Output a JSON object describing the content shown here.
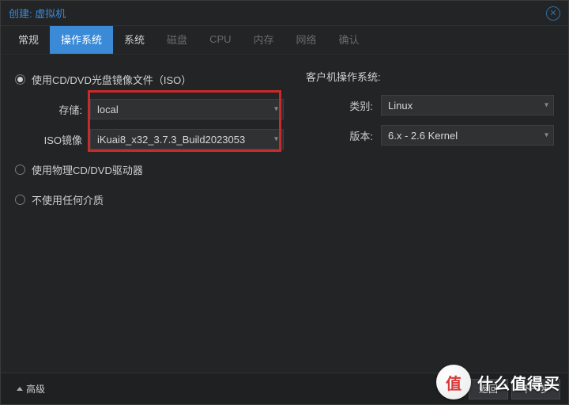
{
  "title": "创建: 虚拟机",
  "tabs": [
    {
      "label": "常规",
      "state": "normal"
    },
    {
      "label": "操作系统",
      "state": "active"
    },
    {
      "label": "系统",
      "state": "normal"
    },
    {
      "label": "磁盘",
      "state": "disabled"
    },
    {
      "label": "CPU",
      "state": "disabled"
    },
    {
      "label": "内存",
      "state": "disabled"
    },
    {
      "label": "网络",
      "state": "disabled"
    },
    {
      "label": "确认",
      "state": "disabled"
    }
  ],
  "media": {
    "options": {
      "iso": "使用CD/DVD光盘镜像文件（ISO）",
      "physical": "使用物理CD/DVD驱动器",
      "none": "不使用任何介质"
    },
    "selected": "iso",
    "storage_label": "存储:",
    "storage_value": "local",
    "iso_label": "ISO镜像",
    "iso_value": "iKuai8_x32_3.7.3_Build2023053"
  },
  "guest": {
    "heading": "客户机操作系统:",
    "type_label": "类别:",
    "type_value": "Linux",
    "version_label": "版本:",
    "version_value": "6.x - 2.6 Kernel"
  },
  "footer": {
    "advanced": "高级",
    "back": "返回",
    "next": "下一步"
  },
  "watermark": {
    "icon": "值",
    "text": "什么值得买"
  }
}
